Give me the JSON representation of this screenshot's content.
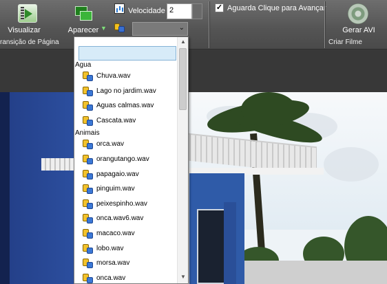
{
  "ribbon": {
    "visualizar_label": "Visualizar",
    "aparecer_label": "Aparecer",
    "velocidade_label": "Velocidade",
    "velocidade_value": "2",
    "aguarda_label": "Aguarda Clique para Avançar",
    "aguarda_checked": true,
    "gerar_avi_label": "Gerar AVI",
    "group_transicao": "ransição de Página",
    "group_criar_filme": "Criar Filme",
    "sound_combo_value": ""
  },
  "dropdown": {
    "search_value": "",
    "groups": [
      {
        "label": "Agua",
        "items": [
          "Chuva.wav",
          "Lago no jardim.wav",
          "Aguas calmas.wav",
          "Cascata.wav"
        ]
      },
      {
        "label": "Animais",
        "items": [
          "orca.wav",
          "orangutango.wav",
          "papagaio.wav",
          "pinguim.wav",
          "peixespinho.wav",
          "onca.wav6.wav",
          "macaco.wav",
          "lobo.wav",
          "morsa.wav",
          "onca.wav"
        ]
      }
    ]
  },
  "icons": {
    "visualizar": "play-preview-icon",
    "aparecer": "transition-icon",
    "velocidade": "speed-chart-icon",
    "sound": "sound-file-icon",
    "gerar_avi": "film-reel-icon"
  }
}
